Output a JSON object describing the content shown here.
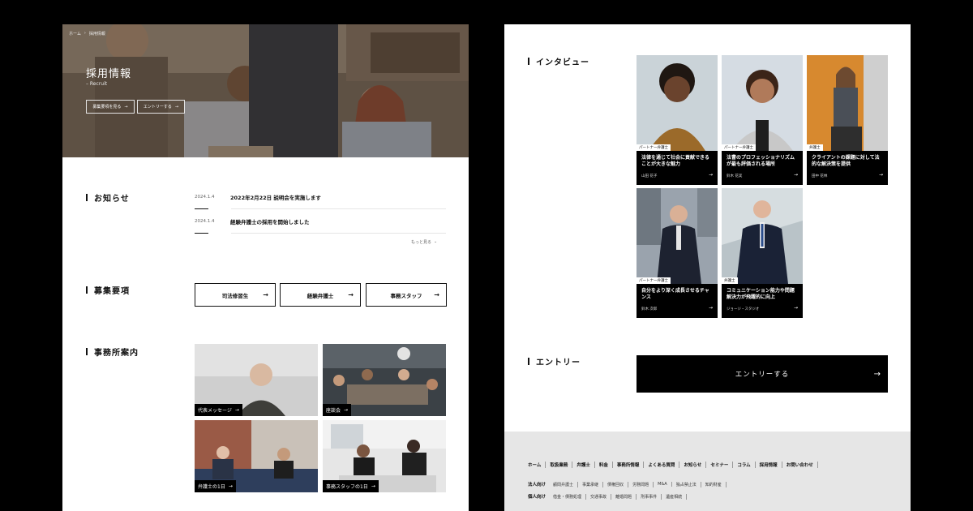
{
  "breadcrumb": [
    "ホーム",
    "›",
    "採用情報"
  ],
  "hero": {
    "title": "採用情報",
    "subtitle": "– Recruit",
    "btn_requirements": "募集要項を見る",
    "btn_entry": "エントリーする"
  },
  "news": {
    "heading": "お知らせ",
    "items": [
      {
        "date": "2024.1.4",
        "text": "2022年2月22日 説明会を実施します"
      },
      {
        "date": "2024.1.4",
        "text": "経験弁護士の採用を開始しました"
      }
    ],
    "more": "もっと見る"
  },
  "recruit": {
    "heading": "募集要項",
    "buttons": [
      "司法修習生",
      "経験弁護士",
      "事務スタッフ"
    ]
  },
  "office": {
    "heading": "事務所案内",
    "tiles": [
      "代表メッセージ",
      "座談会",
      "弁護士の1日",
      "事務スタッフの1日"
    ]
  },
  "interview": {
    "heading": "インタビュー",
    "cards": [
      {
        "role": "パートナー弁護士",
        "quote": "法律を通じて社会に貢献できることが大きな魅力",
        "name": "山田 花子"
      },
      {
        "role": "パートナー弁護士",
        "quote": "法曹のプロフェッショナリズムが最も評価される場所",
        "name": "鈴木 花実"
      },
      {
        "role": "弁護士",
        "quote": "クライアントの課題に対して法的な解決策を提供",
        "name": "田中 花林"
      },
      {
        "role": "パートナー弁護士",
        "quote": "自分をより深く成長させるチャンス",
        "name": "鈴木 次郎"
      },
      {
        "role": "弁護士",
        "quote": "コミュニケーション能力や問題解決力が飛躍的に向上",
        "name": "ジョージ・スタジオ"
      }
    ]
  },
  "entry": {
    "heading": "エントリー",
    "button": "エントリーする"
  },
  "footer": {
    "nav": [
      "ホーム",
      "取扱業務",
      "弁護士",
      "料金",
      "事務所情報",
      "よくある質問",
      "お知らせ",
      "セミナー",
      "コラム",
      "採用情報",
      "お問い合わせ"
    ],
    "corporate_label": "法人向け",
    "corporate": [
      "顧問弁護士",
      "事業承継",
      "債権回収",
      "労務問題",
      "M&A",
      "独占禁止法",
      "知的財産"
    ],
    "personal_label": "個人向け",
    "personal": [
      "借金・債務処理",
      "交通事故",
      "離婚問題",
      "刑事事件",
      "遺産相続"
    ]
  },
  "icons": {
    "arrow": "→",
    "chevron": "⌄"
  }
}
